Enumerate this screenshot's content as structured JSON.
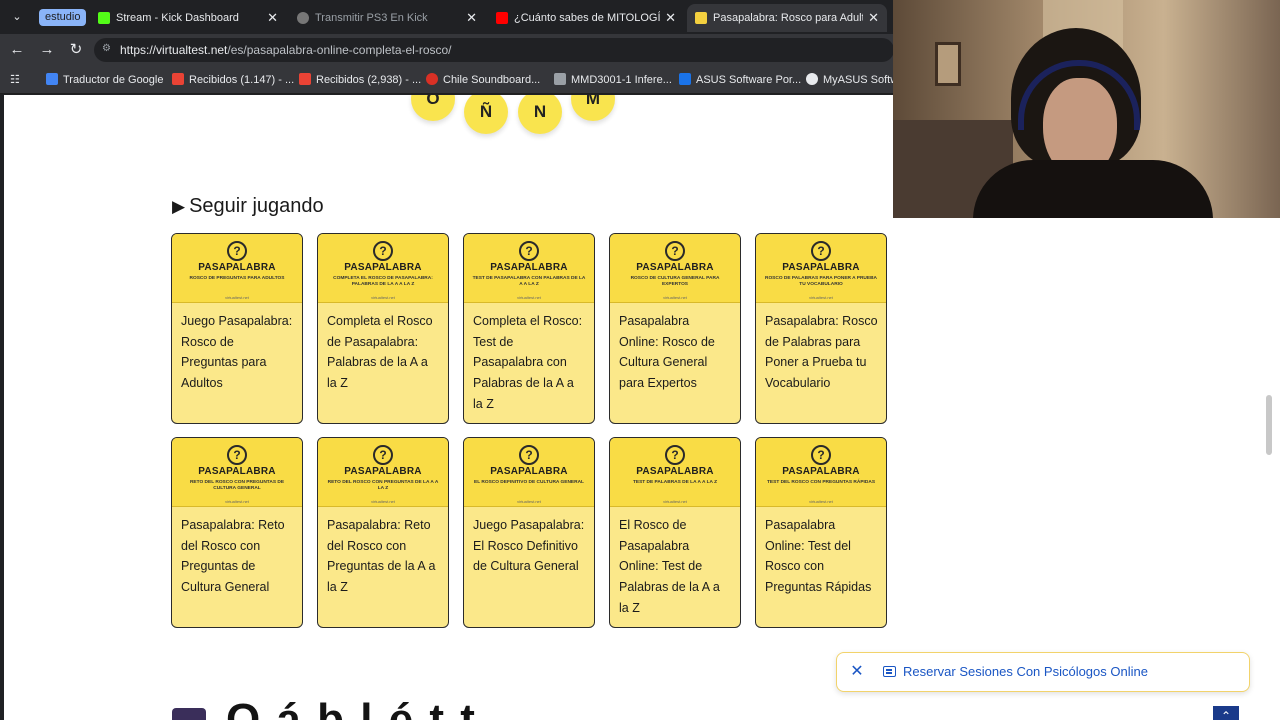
{
  "browser": {
    "tab_group_label": "estudio",
    "tabs": [
      {
        "title": "Stream - Kick Dashboard",
        "favicon_color": "#53fc18",
        "active": false
      },
      {
        "title": "Transmitir PS3 En Kick",
        "favicon_color": "#777777",
        "active": false
      },
      {
        "title": "¿Cuánto sabes de MITOLOGÍA GR",
        "favicon_color": "#ff0000",
        "active": false
      },
      {
        "title": "Pasapalabra: Rosco para Adultos",
        "favicon_color": "#f4d03f",
        "active": true
      }
    ],
    "url_host": "https://virtualtest.net",
    "url_path": "/es/pasapalabra-online-completa-el-rosco/",
    "bookmarks": [
      {
        "label": "Traductor de Google",
        "color": "#4285f4"
      },
      {
        "label": "Recibidos (1.147) - ...",
        "color": "#ea4335"
      },
      {
        "label": "Recibidos (2,938) - ...",
        "color": "#ea4335"
      },
      {
        "label": "Chile Soundboard...",
        "color": "#d93025"
      },
      {
        "label": "MMD3001-1 Infere...",
        "color": "#9aa0a6"
      },
      {
        "label": "ASUS Software Por...",
        "color": "#1a73e8"
      },
      {
        "label": "MyASUS Softwa",
        "color": "#e8eaed"
      }
    ]
  },
  "rosco_letters": [
    "O",
    "Ñ",
    "N",
    "M"
  ],
  "section": {
    "title": "Seguir jugando"
  },
  "cards": [
    {
      "brand": "PASAPALABRA",
      "sub": "ROSCO DE PREGUNTAS PARA ADULTOS",
      "site": "virtualtest.net",
      "label": "Juego Pasapalabra: Rosco de Preguntas para Adultos"
    },
    {
      "brand": "PASAPALABRA",
      "sub": "COMPLETA EL ROSCO DE PASAPALABRA: PALABRAS DE LA A A LA Z",
      "site": "virtualtest.net",
      "label": "Completa el Rosco de Pasapalabra: Palabras de la A a la Z"
    },
    {
      "brand": "PASAPALABRA",
      "sub": "TEST DE PASAPALABRA CON PALABRAS DE LA A A LA Z",
      "site": "virtualtest.net",
      "label": "Completa el Rosco: Test de Pasapalabra con Palabras de la A a la Z"
    },
    {
      "brand": "PASAPALABRA",
      "sub": "ROSCO DE CULTURA GENERAL PARA EXPERTOS",
      "site": "virtualtest.net",
      "label": "Pasapalabra Online: Rosco de Cultura General para Expertos"
    },
    {
      "brand": "PASAPALABRA",
      "sub": "ROSCO DE PALABRAS PARA PONER A PRUEBA TU VOCABULARIO",
      "site": "virtualtest.net",
      "label": "Pasapalabra: Rosco de Palabras para Poner a Prueba tu Vocabulario"
    },
    {
      "brand": "PASAPALABRA",
      "sub": "RETO DEL ROSCO CON PREGUNTAS DE CULTURA GENERAL",
      "site": "virtualtest.net",
      "label": "Pasapalabra: Reto del Rosco con Preguntas de Cultura General"
    },
    {
      "brand": "PASAPALABRA",
      "sub": "RETO DEL ROSCO CON PREGUNTAS DE LA A A LA Z",
      "site": "virtualtest.net",
      "label": "Pasapalabra: Reto del Rosco con Preguntas de la A a la Z"
    },
    {
      "brand": "PASAPALABRA",
      "sub": "EL ROSCO DEFINITIVO DE CULTURA GENERAL",
      "site": "virtualtest.net",
      "label": "Juego Pasapalabra: El Rosco Definitivo de Cultura General"
    },
    {
      "brand": "PASAPALABRA",
      "sub": "TEST DE PALABRAS DE LA A A LA Z",
      "site": "virtualtest.net",
      "label": "El Rosco de Pasapalabra Online: Test de Palabras de la A a la Z"
    },
    {
      "brand": "PASAPALABRA",
      "sub": "TEST DEL ROSCO CON PREGUNTAS RÁPIDAS",
      "site": "virtualtest.net",
      "label": "Pasapalabra Online: Test del Rosco con Preguntas Rápidas"
    }
  ],
  "ad_bar": {
    "text": "Reservar Sesiones Con Psicólogos Online"
  },
  "next_heading_partial": "Q            á            b  l           é           t     t"
}
